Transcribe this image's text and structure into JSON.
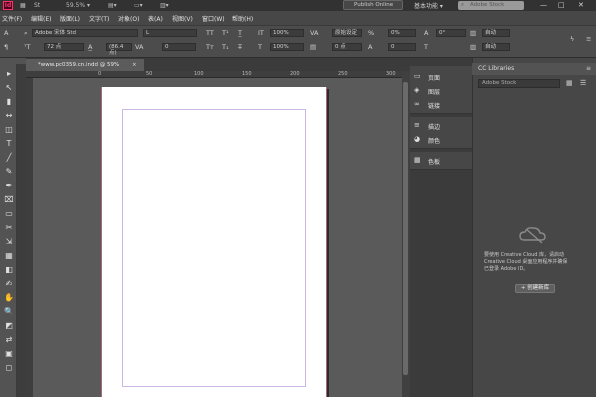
{
  "titlebar": {
    "logo": "Id",
    "zoom": "59.5% ▾",
    "publish_online": "Publish Online",
    "workspace": "基本功能 ▾",
    "stock_search_placeholder": "Adobe Stock",
    "controls": {
      "minimize": "—",
      "maximize": "□",
      "close": "✕"
    }
  },
  "menu": [
    "文件(F)",
    "编辑(E)",
    "版面(L)",
    "文字(T)",
    "对象(O)",
    "表(A)",
    "视图(V)",
    "窗口(W)",
    "帮助(H)"
  ],
  "control": {
    "font_family": "Adobe 宋体 Std",
    "font_style": "L",
    "font_size": "72 点",
    "leading": "(86.4 点)",
    "tracking": "0",
    "kerning": "原始设定",
    "kerning2": "0",
    "scale_v": "100%",
    "scale_h": "100%",
    "baseline": "0 点",
    "skew": "0°",
    "percent": "0%",
    "auto1": "自动",
    "auto2": "自动"
  },
  "document": {
    "tab_label": "*www.pc0359.cn.indd @ 59%",
    "ruler_ticks": [
      "0",
      "50",
      "100",
      "150",
      "200",
      "250",
      "300"
    ]
  },
  "panels": {
    "group1": [
      "页面",
      "图层",
      "链接"
    ],
    "group2": [
      "描边",
      "颜色"
    ],
    "group3": [
      "色板"
    ]
  },
  "cc_libraries": {
    "title": "CC Libraries",
    "dropdown_placeholder": "Adobe Stock",
    "message": [
      "要使用 Creative Cloud 库，请启动",
      "Creative Cloud 桌面应用程序并确保",
      "已登录 Adobe ID。"
    ],
    "button": "+ 创建新库"
  },
  "tools": [
    "▸",
    "↖",
    "▮",
    "↔",
    "◫",
    "T",
    "╱",
    "✎",
    "✒",
    "⌧",
    "▭",
    "✂",
    "⇲",
    "▦",
    "◧",
    "✍",
    "✋",
    "🔍",
    "◩",
    "⇄",
    "▣",
    "◻"
  ]
}
